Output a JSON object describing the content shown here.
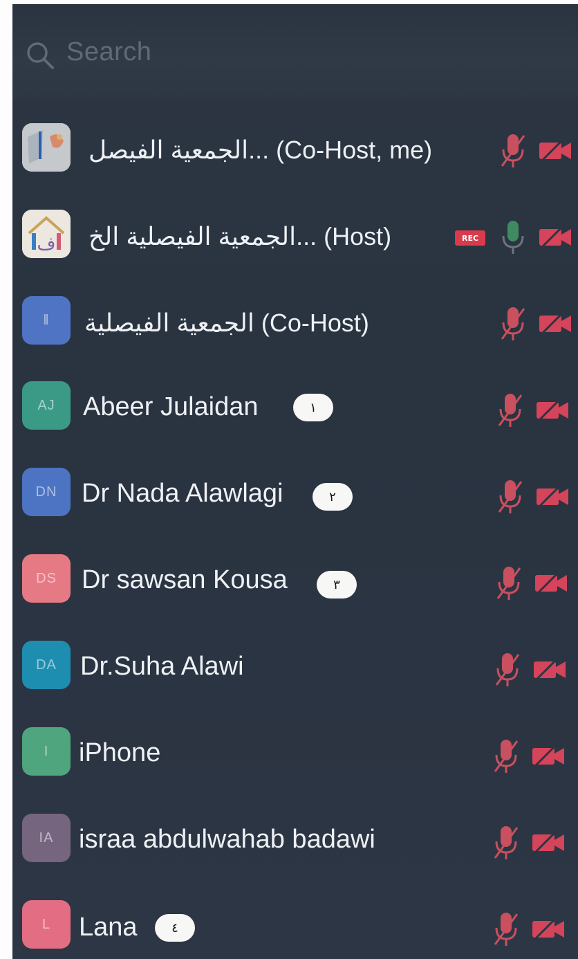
{
  "search": {
    "placeholder": "Search"
  },
  "colors": {
    "muted_red": "#c9505f",
    "cam_red": "#d4445a",
    "mic_green": "#3f8a62"
  },
  "participants": [
    {
      "initials": "",
      "name": "الجمعية الفيصل... (Co-Host, me)",
      "avatar_color": "#c8ccce",
      "mic": "muted",
      "cam": "off",
      "badge": "",
      "rec": ""
    },
    {
      "initials": "",
      "name": "الجمعية الفيصلية الخ... (Host)",
      "avatar_color": "#e8e2da",
      "mic": "on",
      "cam": "off",
      "badge": "",
      "rec": "REC"
    },
    {
      "initials": "‖",
      "name": "الجمعية الفيصلية (Co-Host)",
      "avatar_color": "#4f74c4",
      "mic": "muted",
      "cam": "off",
      "badge": "",
      "rec": ""
    },
    {
      "initials": "AJ",
      "name": "Abeer Julaidan",
      "avatar_color": "#3a9a86",
      "mic": "muted",
      "cam": "off",
      "badge": "١",
      "rec": ""
    },
    {
      "initials": "DN",
      "name": "Dr Nada Alawlagi",
      "avatar_color": "#4d74c2",
      "mic": "muted",
      "cam": "off",
      "badge": "٢",
      "rec": ""
    },
    {
      "initials": "DS",
      "name": "Dr sawsan Kousa",
      "avatar_color": "#e67a84",
      "mic": "muted",
      "cam": "off",
      "badge": "٣",
      "rec": ""
    },
    {
      "initials": "DA",
      "name": "Dr.Suha Alawi",
      "avatar_color": "#1e8eb0",
      "mic": "muted",
      "cam": "off",
      "badge": "",
      "rec": ""
    },
    {
      "initials": "I",
      "name": "iPhone",
      "avatar_color": "#4fa57e",
      "mic": "muted",
      "cam": "off",
      "badge": "",
      "rec": ""
    },
    {
      "initials": "IA",
      "name": "israa abdulwahab badawi",
      "avatar_color": "#76657f",
      "mic": "muted",
      "cam": "off",
      "badge": "",
      "rec": ""
    },
    {
      "initials": "L",
      "name": "Lana",
      "avatar_color": "#e36e84",
      "mic": "muted",
      "cam": "off",
      "badge": "٤",
      "rec": ""
    }
  ]
}
